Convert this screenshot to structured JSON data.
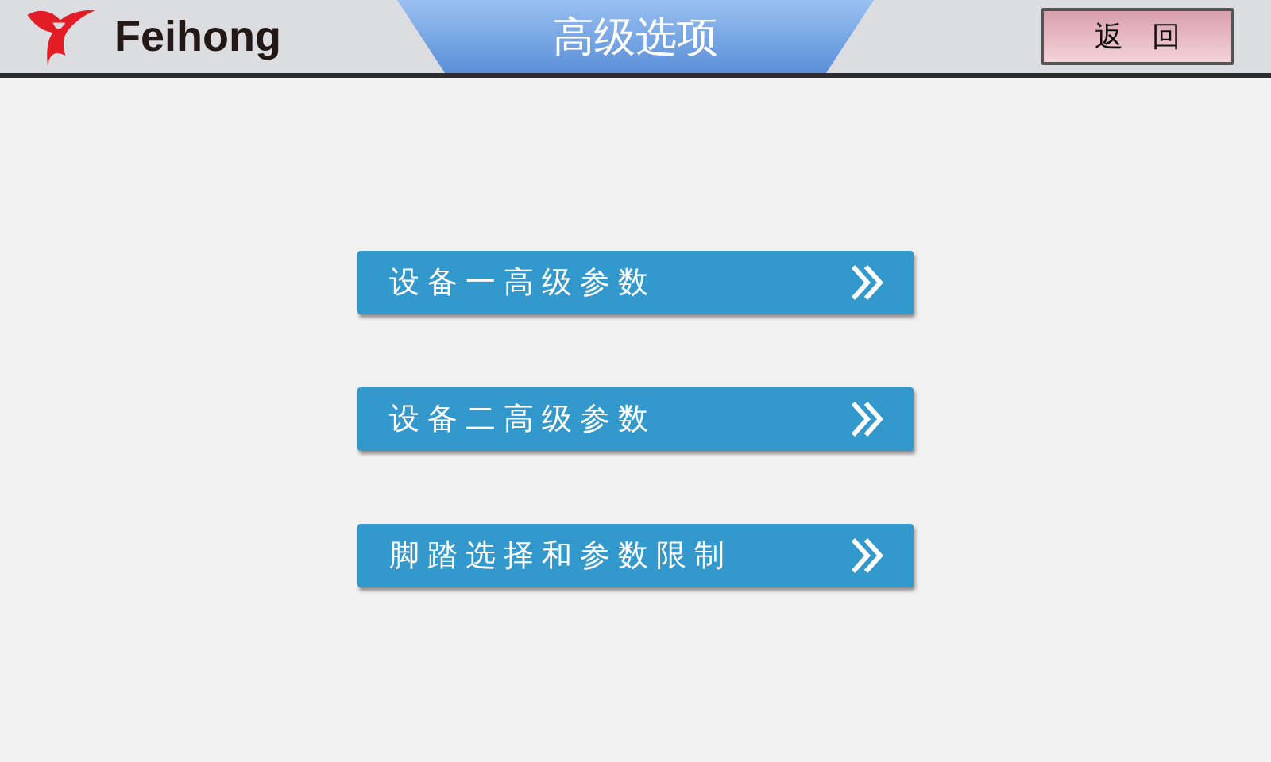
{
  "header": {
    "logo_text": "Feihong",
    "title": "高级选项",
    "back_button": "返　回"
  },
  "menu": [
    {
      "label": "设备一高级参数"
    },
    {
      "label": "设备二高级参数"
    },
    {
      "label": "脚踏选择和参数限制"
    }
  ]
}
